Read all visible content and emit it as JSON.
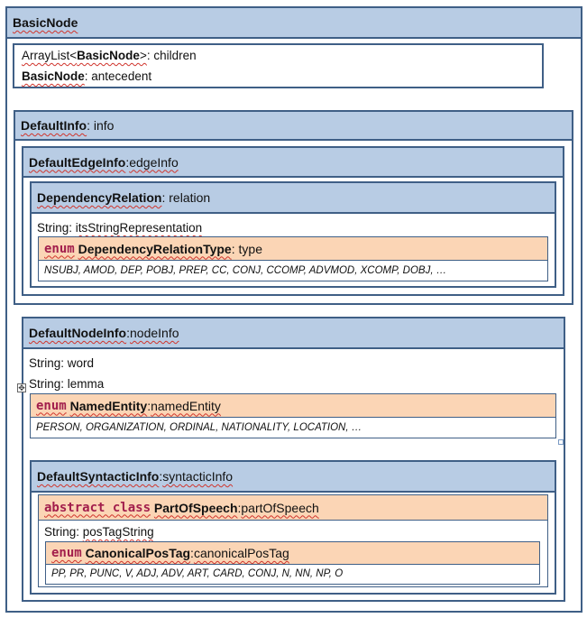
{
  "basic_node": {
    "title": "BasicNode",
    "children_type_prefix": "ArrayList<",
    "children_type_name": "BasicNode",
    "children_type_suffix": ">",
    "children_field": ": children",
    "antecedent_type": "BasicNode",
    "antecedent_field": ": antecedent"
  },
  "default_info": {
    "type": "DefaultInfo",
    "field": ": info",
    "edge_info": {
      "type": "DefaultEdgeInfo",
      "sep": ": ",
      "field": "edgeInfo",
      "relation": {
        "type": "DependencyRelation",
        "field": ": relation",
        "string_type": "String: ",
        "string_field": "itsStringRepresentation",
        "enum": {
          "keyword": "enum",
          "type": "DependencyRelationType",
          "field": ": type",
          "values": "NSUBJ, AMOD, DEP, POBJ, PREP, CC, CONJ, CCOMP, ADVMOD, XCOMP, DOBJ, …"
        }
      }
    }
  },
  "node_info": {
    "type": "DefaultNodeInfo",
    "sep": ": ",
    "field": "nodeInfo",
    "word_type": "String: ",
    "word_field": "word",
    "lemma_type": "String: ",
    "lemma_field": "lemma",
    "named_entity": {
      "keyword": "enum",
      "type": "NamedEntity",
      "sep": ": ",
      "field": "namedEntity",
      "values": "PERSON, ORGANIZATION, ORDINAL, NATIONALITY, LOCATION, …"
    },
    "syntactic_info": {
      "type": "DefaultSyntacticInfo",
      "sep": ": ",
      "field": "syntacticInfo",
      "pos": {
        "keyword": "abstract class",
        "type": "PartOfSpeech",
        "sep": ": ",
        "field": "partOfSpeech",
        "string_type": "String: ",
        "string_field": "posTagString",
        "canonical": {
          "keyword": "enum",
          "type": "CanonicalPosTag",
          "sep": ": ",
          "field": "canonicalPosTag",
          "values": "PP, PR, PUNC, V, ADJ, ADV, ART, CARD, CONJ, N, NN, NP, O"
        }
      }
    }
  }
}
